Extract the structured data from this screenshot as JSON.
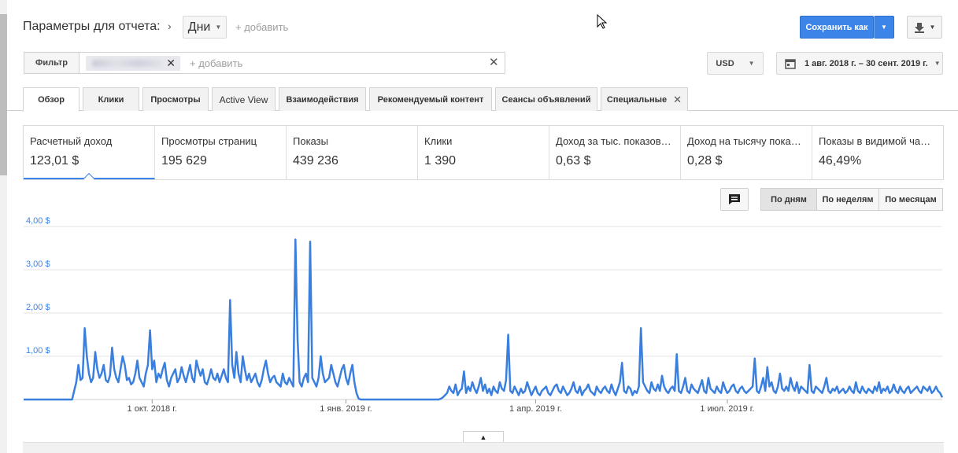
{
  "header": {
    "title": "Параметры для отчета:",
    "period_value": "Дни",
    "add_link": "+ добавить",
    "save_label": "Сохранить как"
  },
  "filter": {
    "label": "Фильтр",
    "add_link": "+ добавить",
    "currency": "USD",
    "date_range": "1 авг. 2018 г. – 30 сент. 2019 г."
  },
  "tabs": [
    {
      "label": "Обзор"
    },
    {
      "label": "Клики"
    },
    {
      "label": "Просмотры"
    },
    {
      "label": "Active View"
    },
    {
      "label": "Взаимодействия"
    },
    {
      "label": "Рекомендуемый контент"
    },
    {
      "label": "Сеансы объявлений"
    },
    {
      "label": "Специальные"
    }
  ],
  "metrics": [
    {
      "label": "Расчетный доход",
      "value": "123,01 $"
    },
    {
      "label": "Просмотры страниц",
      "value": "195 629"
    },
    {
      "label": "Показы",
      "value": "439 236"
    },
    {
      "label": "Клики",
      "value": "1 390"
    },
    {
      "label": "Доход за тыс. показов…",
      "value": "0,63 $"
    },
    {
      "label": "Доход на тысячу пока…",
      "value": "0,28 $"
    },
    {
      "label": "Показы в видимой ча…",
      "value": "46,49%"
    }
  ],
  "granularity": {
    "day": "По дням",
    "week": "По неделям",
    "month": "По месяцам"
  },
  "colors": {
    "accent": "#3c84e8",
    "line": "#3a7fde"
  },
  "chart_data": {
    "type": "line",
    "ylim": [
      0,
      4
    ],
    "yticks": [
      "1,00 $",
      "2,00 $",
      "3,00 $",
      "4,00 $"
    ],
    "ytick_values": [
      1,
      2,
      3,
      4
    ],
    "xticks": [
      "1 окт. 2018 г.",
      "1 янв. 2019 г.",
      "1 апр. 2019 г.",
      "1 июл. 2019 г."
    ],
    "xtick_days": [
      61,
      153,
      243,
      334
    ],
    "x_start": "2018-08-01",
    "x_end": "2019-09-30",
    "series": [
      {
        "values": [
          0,
          0,
          0,
          0,
          0,
          0,
          0,
          0,
          0,
          0,
          0,
          0,
          0,
          0,
          0,
          0,
          0,
          0,
          0,
          0,
          0,
          0,
          0,
          0,
          0.2,
          0.4,
          0.8,
          0.45,
          0.5,
          1.65,
          1.0,
          0.6,
          0.4,
          0.5,
          1.1,
          0.7,
          0.5,
          0.6,
          0.8,
          0.45,
          0.4,
          0.55,
          1.2,
          0.7,
          0.5,
          0.4,
          0.7,
          1.0,
          0.8,
          0.45,
          0.5,
          0.35,
          0.4,
          0.6,
          0.9,
          0.5,
          0.4,
          0.3,
          0.6,
          0.8,
          1.6,
          0.7,
          0.9,
          0.4,
          0.6,
          0.5,
          0.7,
          0.85,
          0.45,
          0.3,
          0.5,
          0.6,
          0.7,
          0.4,
          0.5,
          0.75,
          0.55,
          0.4,
          0.6,
          0.8,
          0.5,
          0.4,
          0.9,
          0.7,
          0.55,
          0.7,
          0.4,
          0.35,
          0.5,
          0.7,
          0.5,
          0.45,
          0.6,
          0.4,
          0.55,
          0.7,
          0.5,
          0.4,
          2.3,
          0.8,
          0.5,
          1.1,
          0.6,
          0.4,
          1.0,
          0.7,
          0.45,
          0.6,
          0.4,
          0.5,
          0.6,
          0.4,
          0.3,
          0.45,
          0.7,
          0.9,
          0.6,
          0.4,
          0.5,
          0.55,
          0.4,
          0.35,
          0.3,
          0.6,
          0.4,
          0.35,
          0.5,
          0.4,
          0.3,
          3.7,
          1.4,
          0.4,
          0.3,
          0.5,
          0.6,
          0.4,
          3.65,
          0.5,
          0.4,
          0.3,
          0.5,
          1.0,
          0.6,
          0.4,
          0.45,
          0.5,
          0.8,
          0.6,
          0.4,
          0.3,
          0.5,
          0.7,
          0.8,
          0.5,
          0.35,
          0.6,
          0.8,
          0.4,
          0.15,
          0.02,
          0,
          0,
          0,
          0,
          0,
          0,
          0,
          0,
          0,
          0,
          0,
          0,
          0,
          0,
          0,
          0,
          0,
          0,
          0,
          0,
          0,
          0,
          0,
          0,
          0,
          0,
          0,
          0,
          0,
          0,
          0,
          0,
          0,
          0,
          0,
          0,
          0,
          0,
          0.02,
          0.05,
          0.1,
          0.15,
          0.3,
          0.2,
          0.15,
          0.35,
          0.1,
          0.2,
          0.25,
          0.65,
          0.15,
          0.3,
          0.2,
          0.4,
          0.25,
          0.15,
          0.3,
          0.5,
          0.2,
          0.35,
          0.15,
          0.25,
          0.1,
          0.3,
          0.2,
          0.15,
          0.4,
          0.25,
          0.2,
          0.45,
          1.5,
          0.2,
          0.15,
          0.3,
          0.2,
          0.1,
          0.25,
          0.15,
          0.2,
          0.4,
          0.25,
          0.1,
          0.2,
          0.3,
          0.15,
          0.1,
          0.2,
          0.25,
          0.3,
          0.15,
          0.1,
          0.2,
          0.3,
          0.35,
          0.2,
          0.15,
          0.3,
          0.2,
          0.1,
          0.15,
          0.25,
          0.4,
          0.2,
          0.15,
          0.3,
          0.1,
          0.2,
          0.25,
          0.35,
          0.2,
          0.15,
          0.1,
          0.3,
          0.2,
          0.15,
          0.25,
          0.3,
          0.2,
          0.15,
          0.35,
          0.2,
          0.1,
          0.25,
          0.4,
          0.85,
          0.2,
          0.15,
          0.3,
          0.25,
          0.1,
          0.2,
          0.15,
          0.3,
          1.65,
          0.4,
          0.3,
          0.2,
          0.15,
          0.4,
          0.25,
          0.2,
          0.35,
          0.2,
          0.55,
          0.3,
          0.2,
          0.15,
          0.25,
          0.3,
          0.2,
          1.05,
          0.2,
          0.15,
          0.3,
          0.5,
          0.2,
          0.15,
          0.35,
          0.25,
          0.2,
          0.15,
          0.3,
          0.45,
          0.2,
          0.15,
          0.5,
          0.25,
          0.2,
          0.15,
          0.3,
          0.2,
          0.15,
          0.4,
          0.25,
          0.15,
          0.2,
          0.3,
          0.35,
          0.2,
          0.15,
          0.25,
          0.3,
          0.2,
          0.15,
          0.2,
          0.25,
          0.3,
          0.95,
          0.2,
          0.15,
          0.3,
          0.5,
          0.2,
          0.75,
          0.3,
          0.4,
          0.2,
          0.15,
          0.3,
          0.6,
          0.25,
          0.2,
          0.3,
          0.2,
          0.5,
          0.3,
          0.2,
          0.4,
          0.15,
          0.3,
          0.25,
          0.2,
          0.15,
          0.8,
          0.2,
          0.15,
          0.3,
          0.25,
          0.2,
          0.15,
          0.3,
          0.5,
          0.2,
          0.15,
          0.25,
          0.2,
          0.3,
          0.15,
          0.2,
          0.25,
          0.15,
          0.2,
          0.3,
          0.2,
          0.15,
          0.4,
          0.2,
          0.15,
          0.3,
          0.2,
          0.15,
          0.25,
          0.2,
          0.15,
          0.3,
          0.2,
          0.4,
          0.15,
          0.25,
          0.2,
          0.3,
          0.15,
          0.2,
          0.35,
          0.2,
          0.15,
          0.3,
          0.2,
          0.15,
          0.25,
          0.3,
          0.15,
          0.2,
          0.25,
          0.3,
          0.2,
          0.15,
          0.3,
          0.25,
          0.2,
          0.3,
          0.15,
          0.2,
          0.3,
          0.2,
          0.15,
          0.05
        ]
      }
    ]
  }
}
